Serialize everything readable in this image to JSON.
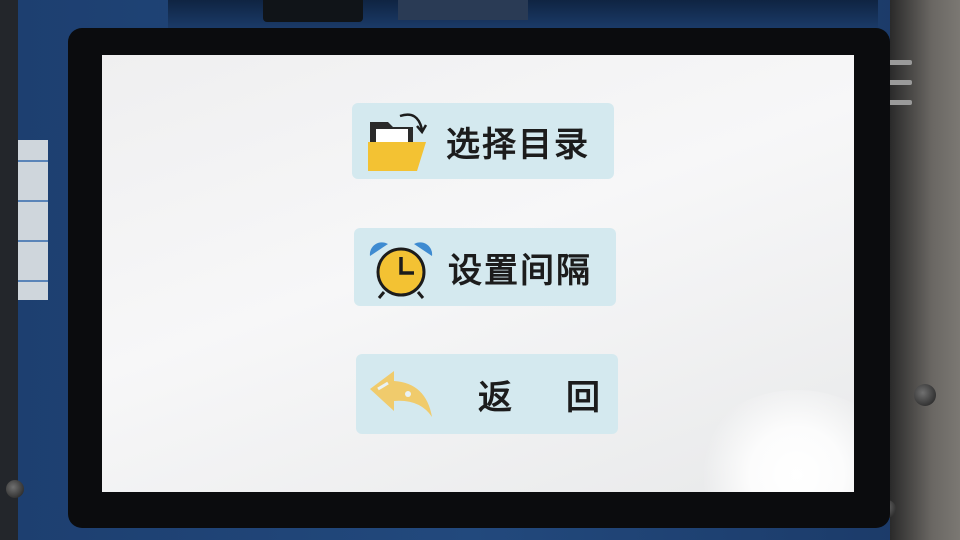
{
  "menu": {
    "items": [
      {
        "label": "选择目录",
        "icon": "folder-open-icon"
      },
      {
        "label": "设置间隔",
        "icon": "alarm-clock-icon"
      },
      {
        "label": "返回",
        "icon": "back-arrow-icon"
      }
    ]
  },
  "colors": {
    "button_bg": "#d4e9ef",
    "screen_bg": "#f2f2f3",
    "icon_yellow": "#f3c233",
    "icon_blue": "#3e8bd1",
    "label_text": "#1c1c1c"
  }
}
